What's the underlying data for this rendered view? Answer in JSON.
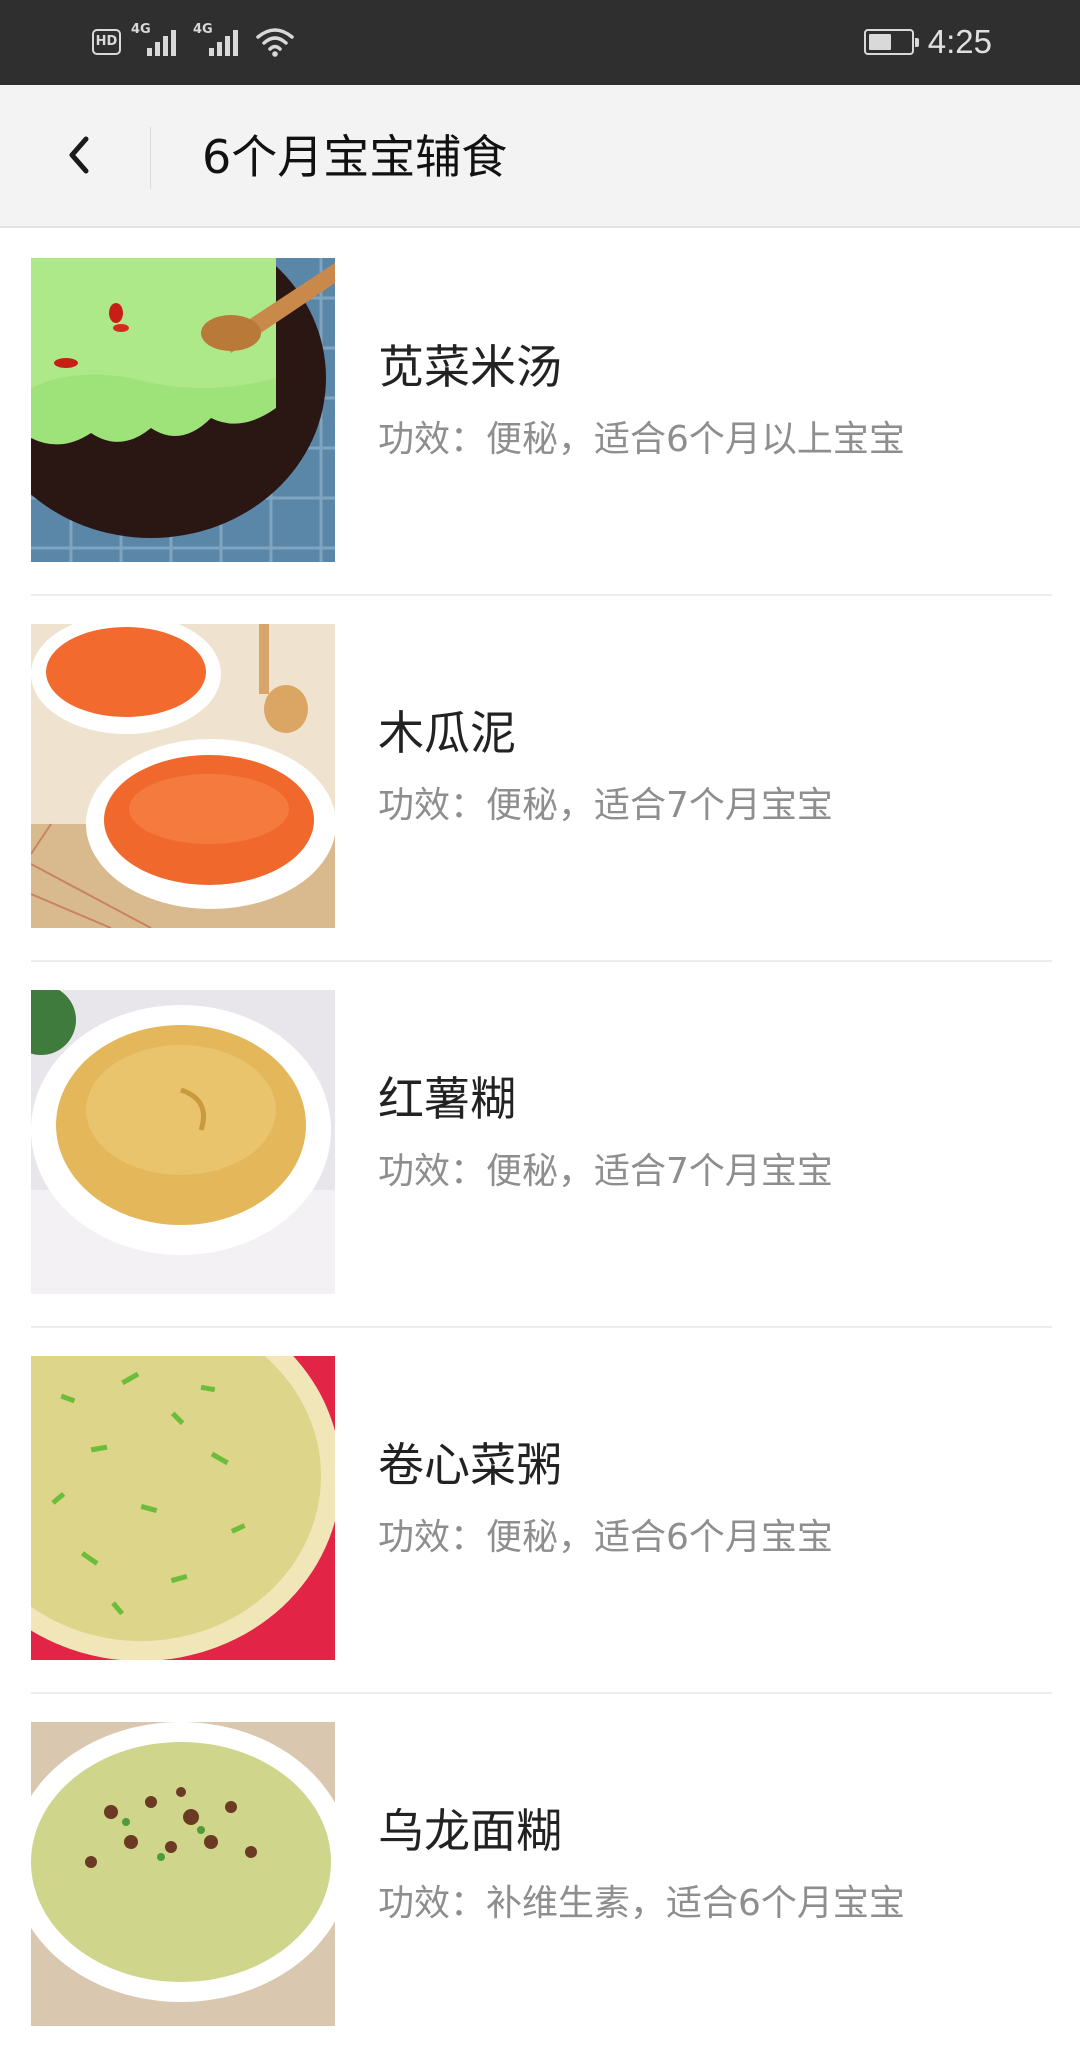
{
  "status_bar": {
    "hd_label": "HD",
    "sim1_label": "4G",
    "sim2_label": "4G",
    "battery_level": 0.55,
    "time": "4:25",
    "icons": [
      "hd-icon",
      "signal-icon",
      "signal-icon",
      "wifi-icon",
      "battery-icon"
    ]
  },
  "header": {
    "back_icon": "chevron-left-icon",
    "title": "6个月宝宝辅食"
  },
  "recipes": [
    {
      "title": "苋菜米汤",
      "desc": "功效：便秘，适合6个月以上宝宝"
    },
    {
      "title": "木瓜泥",
      "desc": "功效：便秘，适合7个月宝宝"
    },
    {
      "title": "红薯糊",
      "desc": "功效：便秘，适合7个月宝宝"
    },
    {
      "title": "卷心菜粥",
      "desc": "功效：便秘，适合6个月宝宝"
    },
    {
      "title": "乌龙面糊",
      "desc": "功效：补维生素，适合6个月宝宝"
    }
  ]
}
